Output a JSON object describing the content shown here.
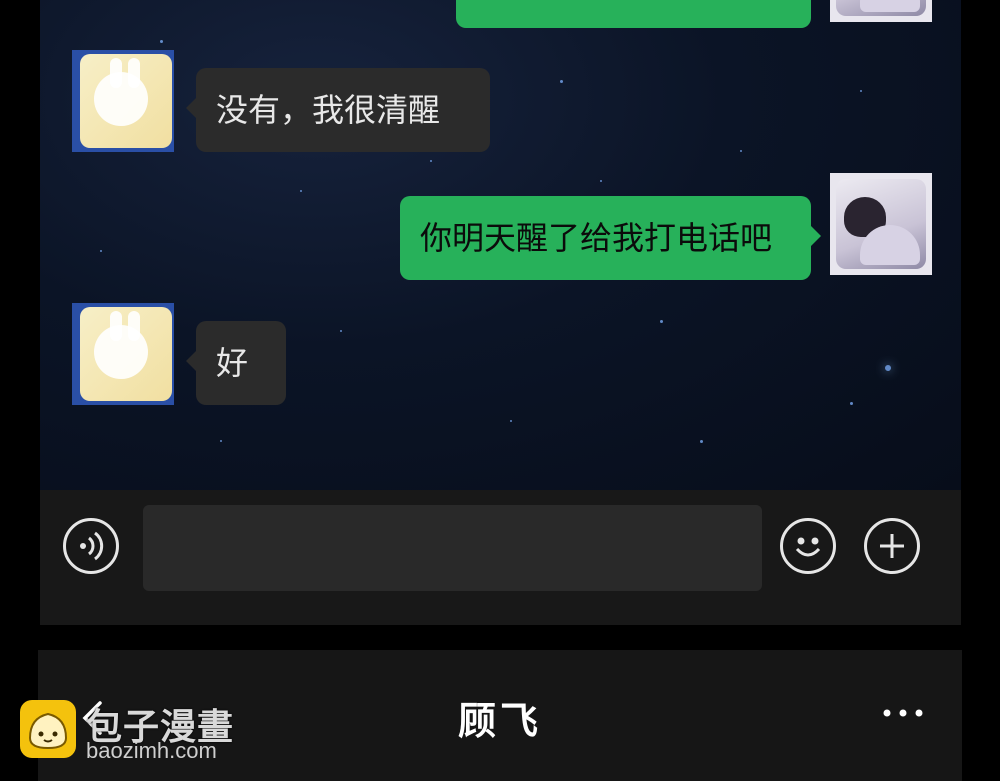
{
  "chat": {
    "messages": [
      {
        "side": "out",
        "text": "",
        "avatar": "boy-avatar"
      },
      {
        "side": "in",
        "text": "没有，我很清醒",
        "avatar": "bunny-avatar"
      },
      {
        "side": "out",
        "text": "你明天醒了给我打电话吧",
        "avatar": "boy-avatar"
      },
      {
        "side": "in",
        "text": "好",
        "avatar": "bunny-avatar"
      }
    ]
  },
  "input_bar": {
    "voice_icon": "voice-icon",
    "emoji_icon": "emoji-icon",
    "plus_icon": "plus-icon",
    "text_value": ""
  },
  "nav": {
    "title": "顾飞",
    "back_icon": "back-chevron-icon",
    "more_icon": "more-dots-icon"
  },
  "watermark": {
    "title": "包子漫畫",
    "url": "baozimh.com"
  },
  "colors": {
    "outgoing_bubble": "#27b15a",
    "incoming_bubble": "#2b2b2b",
    "background": "#0b1222",
    "logo": "#f4c20d"
  }
}
